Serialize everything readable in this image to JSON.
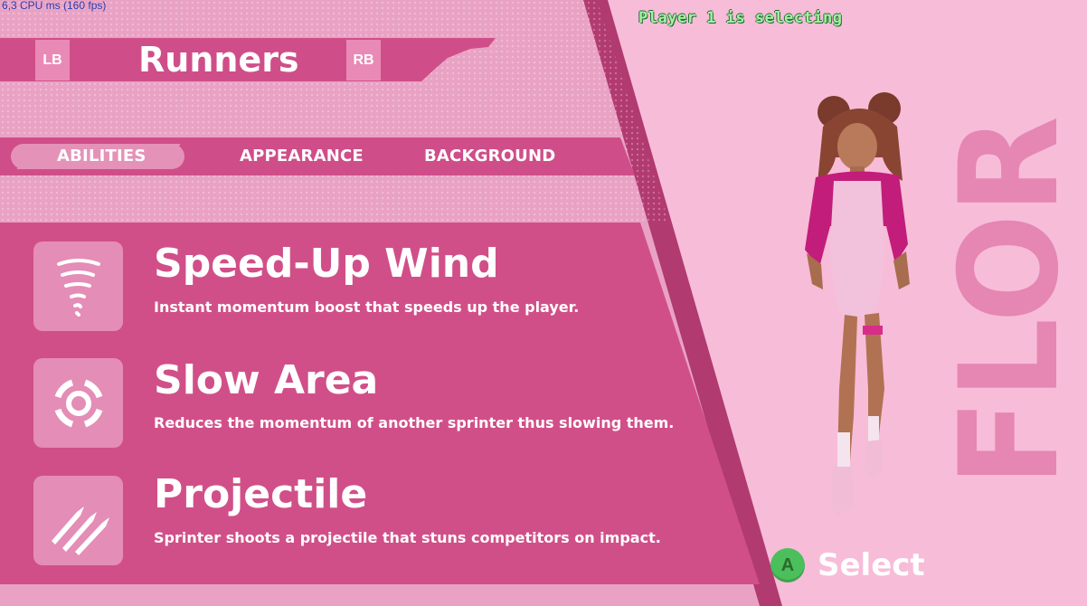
{
  "debug": {
    "fps_text": "6,3 CPU ms (160 fps)"
  },
  "header": {
    "lb_label": "LB",
    "rb_label": "RB",
    "title": "Runners"
  },
  "tabs": [
    {
      "label": "ABILITIES",
      "active": true
    },
    {
      "label": "APPEARANCE",
      "active": false
    },
    {
      "label": "BACKGROUND",
      "active": false
    }
  ],
  "abilities": [
    {
      "icon": "tornado-icon",
      "name": "Speed-Up Wind",
      "description": "Instant momentum boost that speeds up the player."
    },
    {
      "icon": "target-ring-icon",
      "name": "Slow Area",
      "description": "Reduces the momentum of another sprinter thus slowing them."
    },
    {
      "icon": "rockets-icon",
      "name": "Projectile",
      "description": "Sprinter shoots a projectile that stuns competitors on impact."
    }
  ],
  "status": {
    "text": "Player 1 is selecting"
  },
  "character": {
    "name": "FLOR"
  },
  "prompt": {
    "button": "A",
    "label": "Select"
  },
  "colors": {
    "panel": "#d14f88",
    "panel_light": "#e48db6",
    "background": "#f7bcd8",
    "diagonal_band": "#b13a70",
    "name_color": "#e586b3",
    "status_green": "#a7f0a0"
  }
}
